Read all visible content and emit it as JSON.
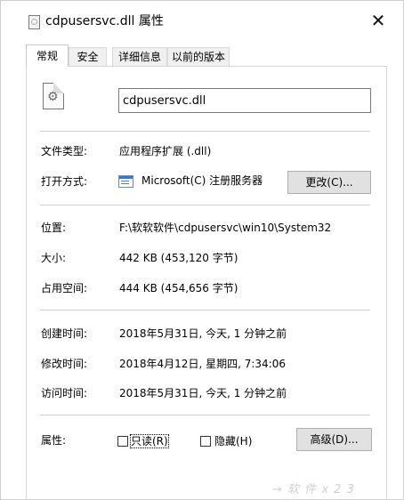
{
  "window": {
    "title": "cdpusersvc.dll 属性",
    "close_glyph": "✕"
  },
  "tabs": [
    {
      "label": "常规",
      "active": true
    },
    {
      "label": "安全",
      "active": false
    },
    {
      "label": "详细信息",
      "active": false
    },
    {
      "label": "以前的版本",
      "active": false
    }
  ],
  "general": {
    "file_name": "cdpusersvc.dll",
    "file_type_label": "文件类型:",
    "file_type_value": "应用程序扩展 (.dll)",
    "open_with_label": "打开方式:",
    "open_with_app": "Microsoft(C) 注册服务器",
    "change_button": "更改(C)...",
    "location_label": "位置:",
    "location_value": "F:\\软软软件\\cdpusersvc\\win10\\System32",
    "size_label": "大小:",
    "size_value": "442 KB (453,120 字节)",
    "size_on_disk_label": "占用空间:",
    "size_on_disk_value": "444 KB (454,656 字节)",
    "created_label": "创建时间:",
    "created_value": "2018年5月31日, 今天, 1 分钟之前",
    "modified_label": "修改时间:",
    "modified_value": "2018年4月12日, 星期四, 7:34:06",
    "accessed_label": "访问时间:",
    "accessed_value": "2018年5月31日, 今天, 1 分钟之前",
    "attributes_label": "属性:",
    "readonly_label": "只读(R)",
    "readonly_checked": false,
    "hidden_label": "隐藏(H)",
    "hidden_checked": false,
    "advanced_button": "高级(D)..."
  },
  "watermark": "→ 软 件 x 2 3"
}
